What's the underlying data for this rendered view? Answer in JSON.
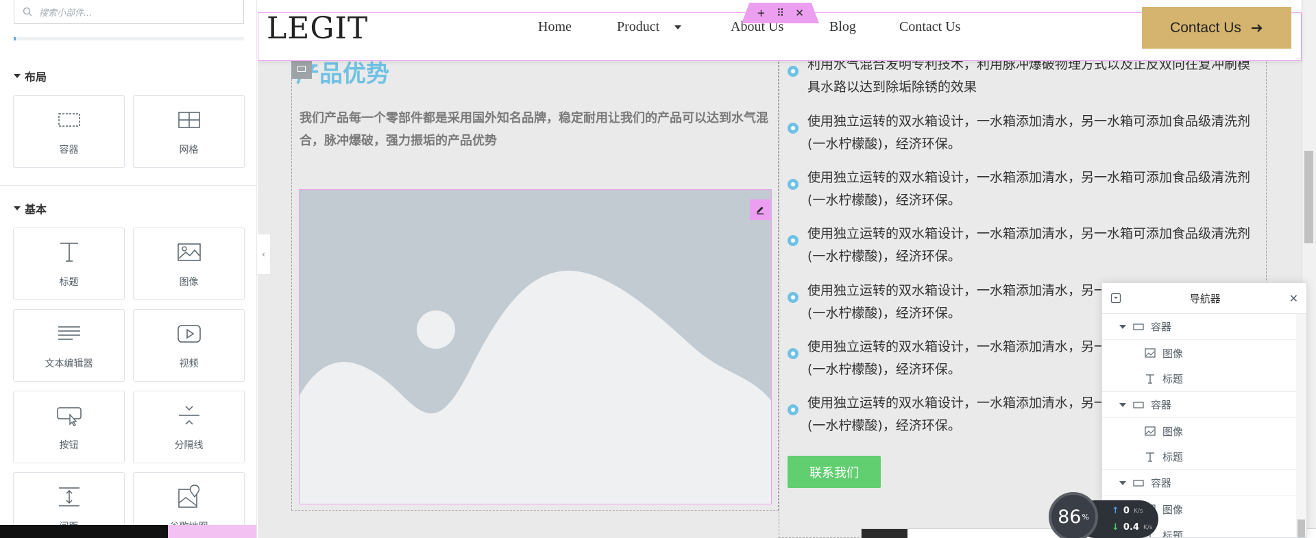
{
  "left_panel": {
    "search_placeholder": "搜索小部件...",
    "sections": [
      {
        "title": "布局",
        "widgets": [
          {
            "label": "容器",
            "icon": "container-icon"
          },
          {
            "label": "网格",
            "icon": "grid-icon"
          }
        ]
      },
      {
        "title": "基本",
        "widgets": [
          {
            "label": "标题",
            "icon": "heading-icon"
          },
          {
            "label": "图像",
            "icon": "image-icon"
          },
          {
            "label": "文本编辑器",
            "icon": "text-editor-icon"
          },
          {
            "label": "视频",
            "icon": "video-icon"
          },
          {
            "label": "按钮",
            "icon": "button-icon"
          },
          {
            "label": "分隔线",
            "icon": "divider-icon"
          },
          {
            "label": "间距",
            "icon": "spacer-icon"
          },
          {
            "label": "谷歌地图",
            "icon": "map-icon"
          }
        ]
      }
    ]
  },
  "header": {
    "logo": "LEGIT",
    "nav": [
      "Home",
      "Product",
      "About Us",
      "Blog",
      "Contact Us"
    ],
    "cta_label": "Contact Us",
    "accent": "#d4b46e"
  },
  "content": {
    "title": "产品优势",
    "description": "我们产品每一个零部件都是采用国外知名品牌，稳定耐用让我们的产品可以达到水气混合，脉冲爆破，强力振垢的产品优势",
    "features": [
      "利用水气混合发明专利技术，利用脉冲爆破物理方式以及正反双向往复冲刷模具水路以达到除垢除锈的效果",
      "使用独立运转的双水箱设计，一水箱添加清水，另一水箱可添加食品级清洗剂(一水柠檬酸)，经济环保。",
      "使用独立运转的双水箱设计，一水箱添加清水，另一水箱可添加食品级清洗剂(一水柠檬酸)，经济环保。",
      "使用独立运转的双水箱设计，一水箱添加清水，另一水箱可添加食品级清洗剂(一水柠檬酸)，经济环保。",
      "使用独立运转的双水箱设计，一水箱添加清水，另一水箱可添加食品级清洗剂(一水柠檬酸)，经济环保。",
      "使用独立运转的双水箱设计，一水箱添加清水，另一水箱可添加食品级清洗剂(一水柠檬酸)，经济环保。",
      "使用独立运转的双水箱设计，一水箱添加清水，另一水箱可添加食品级清洗剂(一水柠檬酸)，经济环保。"
    ],
    "contact_button": "联系我们",
    "title_color": "#6ec1e4",
    "button_color": "#61ce70"
  },
  "navigator": {
    "title": "导航器",
    "items": [
      {
        "type": "container",
        "label": "容器"
      },
      {
        "type": "child",
        "label": "图像",
        "icon": "image-icon"
      },
      {
        "type": "child",
        "label": "标题",
        "icon": "heading-icon"
      },
      {
        "type": "container",
        "label": "容器"
      },
      {
        "type": "child",
        "label": "图像",
        "icon": "image-icon"
      },
      {
        "type": "child",
        "label": "标题",
        "icon": "heading-icon"
      },
      {
        "type": "container",
        "label": "容器"
      },
      {
        "type": "child",
        "label": "图像",
        "icon": "image-icon"
      },
      {
        "type": "child",
        "label": "标题",
        "icon": "heading-icon"
      }
    ]
  },
  "speed": {
    "percent": "86",
    "unit": "%",
    "upload": "0",
    "download": "0.4",
    "rate_unit": "K/s"
  }
}
